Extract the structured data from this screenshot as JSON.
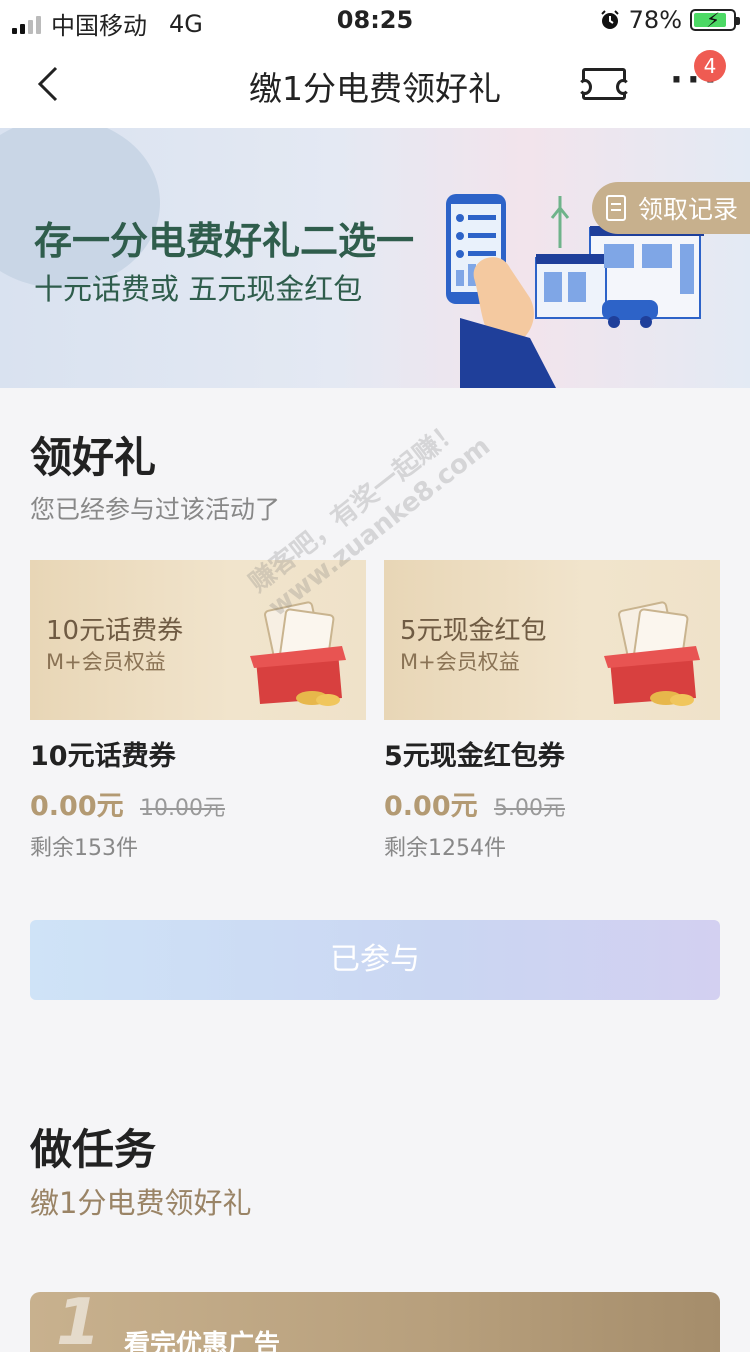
{
  "status_bar": {
    "carrier": "中国移动",
    "network": "4G",
    "time": "08:25",
    "battery": "78%",
    "battery_level": 0.78
  },
  "nav": {
    "title": "缴1分电费领好礼",
    "more": "···",
    "badge": "4"
  },
  "banner": {
    "headline": "存一分电费好礼二选一",
    "subline": "十元话费或 五元现金红包",
    "record_button": "领取记录"
  },
  "gift_section": {
    "title": "领好礼",
    "subtitle": "您已经参与过该活动了",
    "items": [
      {
        "image_title": "10元话费券",
        "image_subtitle": "M+会员权益",
        "name": "10元话费券",
        "price": "0.00元",
        "original_price": "10.00元",
        "stock": "剩余153件"
      },
      {
        "image_title": "5元现金红包",
        "image_subtitle": "M+会员权益",
        "name": "5元现金红包券",
        "price": "0.00元",
        "original_price": "5.00元",
        "stock": "剩余1254件"
      }
    ],
    "button": "已参与"
  },
  "task_section": {
    "title": "做任务",
    "subtitle": "缴1分电费领好礼",
    "first_task_number": "1",
    "first_task_text": "看完优惠广告"
  },
  "watermark": [
    "赚客吧，有奖一起赚！",
    "www.zuanke8.com"
  ],
  "colors": {
    "accent_gold": "#b39a73",
    "banner_green": "#2f5d4c",
    "badge_red": "#ef5b52",
    "button_gradient": "#cfe3f7"
  }
}
